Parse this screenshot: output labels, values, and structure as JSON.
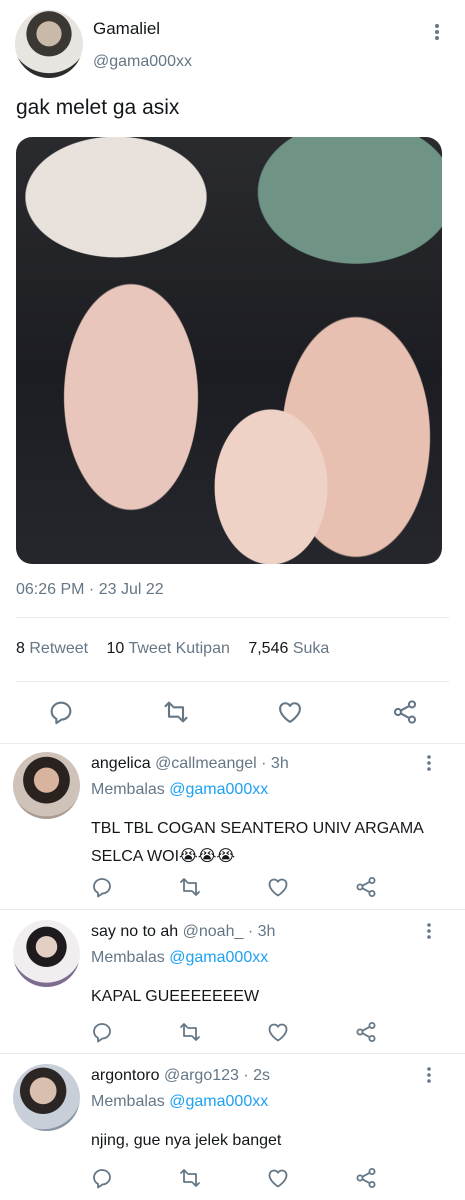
{
  "tweet": {
    "author_name": "Gamaliel",
    "author_handle": "@gama000xx",
    "text": "gak melet ga asix",
    "timestamp": "06:26 PM · 23 Jul 22",
    "stats": {
      "retweet_count": "8",
      "retweet_label": "Retweet",
      "quote_count": "10",
      "quote_label": "Tweet Kutipan",
      "like_count": "7,546",
      "like_label": "Suka"
    },
    "more_icon": "more-vertical-icon"
  },
  "action_icons": [
    "reply-icon",
    "retweet-icon",
    "like-icon",
    "share-icon"
  ],
  "replies": [
    {
      "name": "angelica",
      "handle": "@callmeangel",
      "time": "· 3h",
      "replying_prefix": "Membalas",
      "replying_to": "@gama000xx",
      "text": "TBL TBL COGAN SEANTERO UNIV ARGAMA SELCA WOI😭😭😭"
    },
    {
      "name": "say no to ah",
      "handle": "@noah_",
      "time": "· 3h",
      "replying_prefix": "Membalas",
      "replying_to": "@gama000xx",
      "text": "KAPAL GUEEEEEEEW"
    },
    {
      "name": "argontoro",
      "handle": "@argo123",
      "time": "· 2s",
      "replying_prefix": "Membalas",
      "replying_to": "@gama000xx",
      "text": "njing, gue nya jelek banget"
    }
  ],
  "colors": {
    "link_blue": "#1da1f2",
    "muted_gray": "#657786",
    "text_dark": "#14171a",
    "divider": "#e6ecf0"
  }
}
